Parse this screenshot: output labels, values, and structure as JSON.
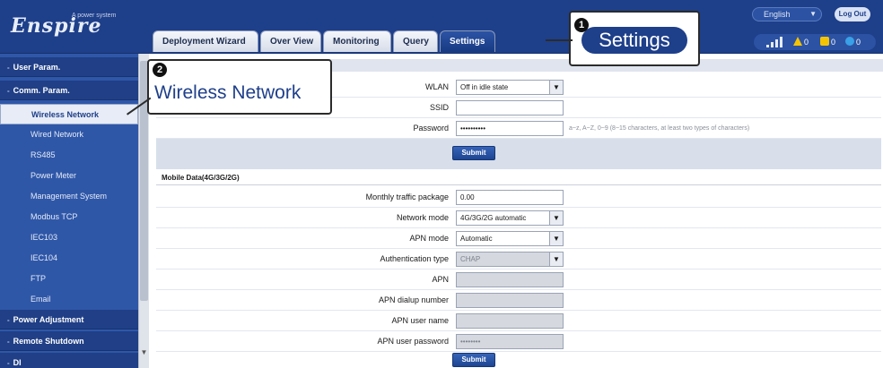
{
  "header": {
    "logo_text": "Enspire",
    "logo_sub": "A power system",
    "language": "English",
    "logout_label": "Log Out",
    "tabs": [
      {
        "label": "Deployment Wizard",
        "active": false
      },
      {
        "label": "Over View",
        "active": false
      },
      {
        "label": "Monitoring",
        "active": false
      },
      {
        "label": "Query",
        "active": false
      },
      {
        "label": "Settings",
        "active": true
      }
    ],
    "alarms": {
      "major": "0",
      "minor": "0",
      "warning": "0"
    }
  },
  "sidebar": {
    "groups": [
      {
        "label": "User Param.",
        "mark": "-"
      },
      {
        "label": "Comm. Param.",
        "mark": "-"
      },
      {
        "label": "Power Adjustment",
        "mark": "-"
      },
      {
        "label": "Remote Shutdown",
        "mark": "-"
      },
      {
        "label": "DI",
        "mark": "-"
      }
    ],
    "items": [
      {
        "label": "Wireless Network",
        "selected": true
      },
      {
        "label": "Wired Network",
        "selected": false
      },
      {
        "label": "RS485",
        "selected": false
      },
      {
        "label": "Power Meter",
        "selected": false
      },
      {
        "label": "Management System",
        "selected": false
      },
      {
        "label": "Modbus TCP",
        "selected": false
      },
      {
        "label": "IEC103",
        "selected": false
      },
      {
        "label": "IEC104",
        "selected": false
      },
      {
        "label": "FTP",
        "selected": false
      },
      {
        "label": "Email",
        "selected": false
      }
    ]
  },
  "wlan_section": {
    "fields": [
      {
        "label": "WLAN",
        "value": "Off in idle state",
        "type": "select"
      },
      {
        "label": "SSID",
        "value": "",
        "type": "text"
      },
      {
        "label": "Password",
        "value": "••••••••••",
        "type": "password",
        "hint": "a~z, A~Z, 0~9 (8~15 characters, at least two types of characters)"
      }
    ],
    "submit_label": "Submit"
  },
  "mobile_section": {
    "title": "Mobile Data(4G/3G/2G)",
    "fields": [
      {
        "label": "Monthly traffic package",
        "value": "0.00",
        "type": "text"
      },
      {
        "label": "Network mode",
        "value": "4G/3G/2G automatic",
        "type": "select"
      },
      {
        "label": "APN mode",
        "value": "Automatic",
        "type": "select"
      },
      {
        "label": "Authentication type",
        "value": "CHAP",
        "type": "select-disabled"
      },
      {
        "label": "APN",
        "value": "",
        "type": "disabled"
      },
      {
        "label": "APN dialup number",
        "value": "",
        "type": "disabled"
      },
      {
        "label": "APN user name",
        "value": "",
        "type": "disabled"
      },
      {
        "label": "APN user password",
        "value": "••••••••",
        "type": "disabled"
      }
    ],
    "submit_label": "Submit"
  },
  "callouts": {
    "settings": {
      "number": "1",
      "text": "Settings"
    },
    "wireless": {
      "number": "2",
      "text": "Wireless Network"
    }
  },
  "colors": {
    "brand_blue": "#1e3f8a",
    "sidebar_blue": "#2f57a8",
    "alarm_yellow": "#f5c400",
    "info_blue": "#3aa0e8"
  },
  "icons": [
    "signal-icon",
    "major-alarm-icon",
    "minor-alarm-icon",
    "warning-alarm-icon",
    "chevron-down-icon"
  ]
}
